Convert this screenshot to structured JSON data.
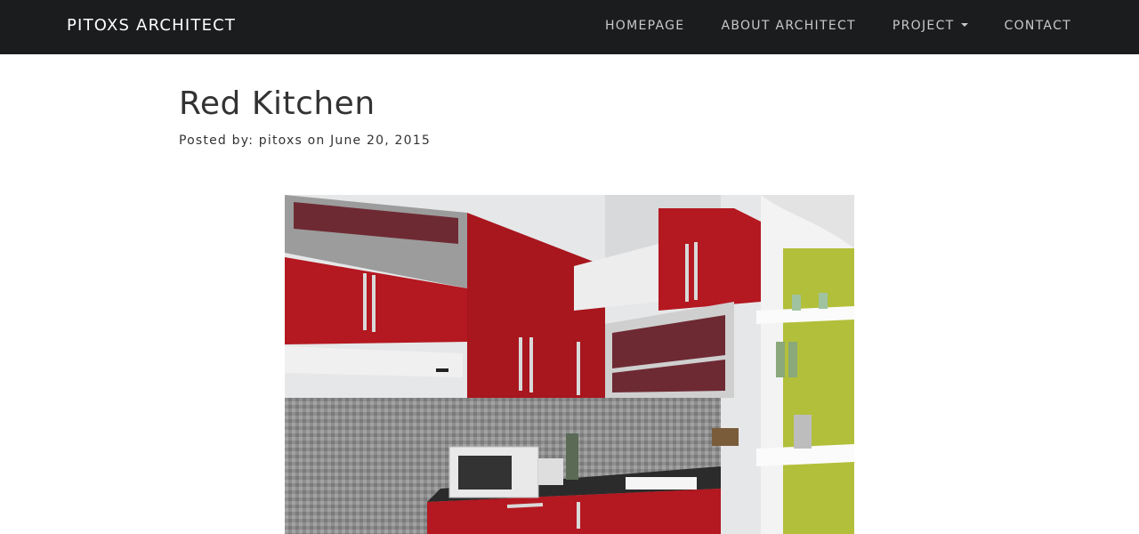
{
  "navbar": {
    "brand": "PITOXS ARCHITECT",
    "links": [
      {
        "label": "HOMEPAGE"
      },
      {
        "label": "ABOUT ARCHITECT"
      },
      {
        "label": "PROJECT",
        "has_dropdown": true
      },
      {
        "label": "CONTACT"
      }
    ]
  },
  "post": {
    "title": "Red Kitchen",
    "meta": "Posted by: pitoxs on June 20, 2015",
    "image": {
      "subject": "red-kitchen-render"
    }
  },
  "colors": {
    "navbar_bg": "#1b1c1e",
    "cabinet_red": "#b41820",
    "wall_green": "#b2bf3a"
  }
}
